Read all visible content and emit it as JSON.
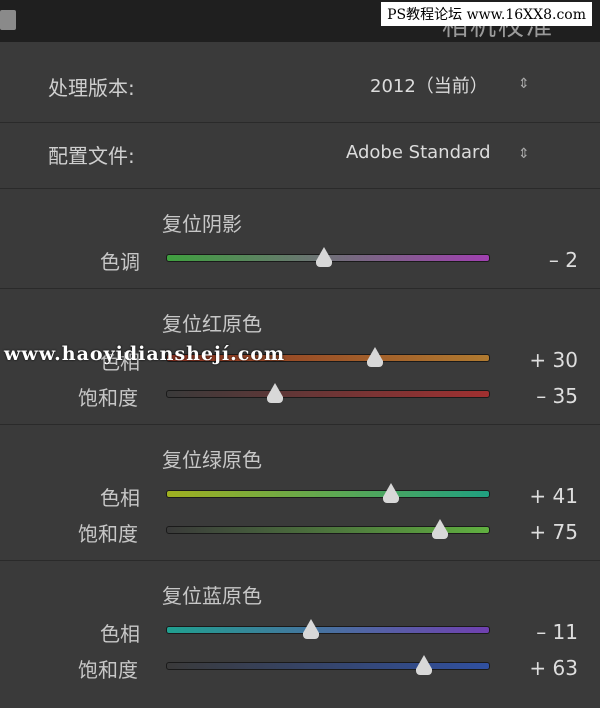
{
  "header": {
    "title": "相机校准",
    "watermark_badge": "PS教程论坛 www.16XX8.com"
  },
  "process": {
    "label": "处理版本:",
    "value": "2012（当前）",
    "updown": "⇕"
  },
  "profile": {
    "label": "配置文件:",
    "value": "Adobe Standard",
    "updown": "⇕"
  },
  "shadows": {
    "title": "复位阴影",
    "tint_label": "色调",
    "tint_value": "– 2",
    "tint_level": 0.49
  },
  "red": {
    "title": "复位红原色",
    "hue_label": "色相",
    "hue_value": "+ 30",
    "hue_level": 0.65,
    "sat_label": "饱和度",
    "sat_value": "– 35",
    "sat_level": 0.34
  },
  "green": {
    "title": "复位绿原色",
    "hue_label": "色相",
    "hue_value": "+ 41",
    "hue_level": 0.7,
    "sat_label": "饱和度",
    "sat_value": "+ 75",
    "sat_level": 0.85
  },
  "blue": {
    "title": "复位蓝原色",
    "hue_label": "色相",
    "hue_value": "– 11",
    "hue_level": 0.45,
    "sat_label": "饱和度",
    "sat_value": "+ 63",
    "sat_level": 0.8
  },
  "overlay_watermark": "www.haoyidianshejí.com",
  "colors": {
    "panel": "#3a3a3a",
    "shadow_track": [
      "#3fa03f",
      "#a040b0"
    ],
    "red_hue_track": [
      "#8a3020",
      "#b07a30"
    ],
    "red_sat_track": [
      "#3a3a3a",
      "#a03030"
    ],
    "green_hue_track": [
      "#a0b020",
      "#20a080"
    ],
    "green_sat_track": [
      "#3a3a3a",
      "#60b040"
    ],
    "blue_hue_track": [
      "#20a090",
      "#7040b0"
    ],
    "blue_sat_track": [
      "#3a3a3a",
      "#3050a0"
    ]
  }
}
